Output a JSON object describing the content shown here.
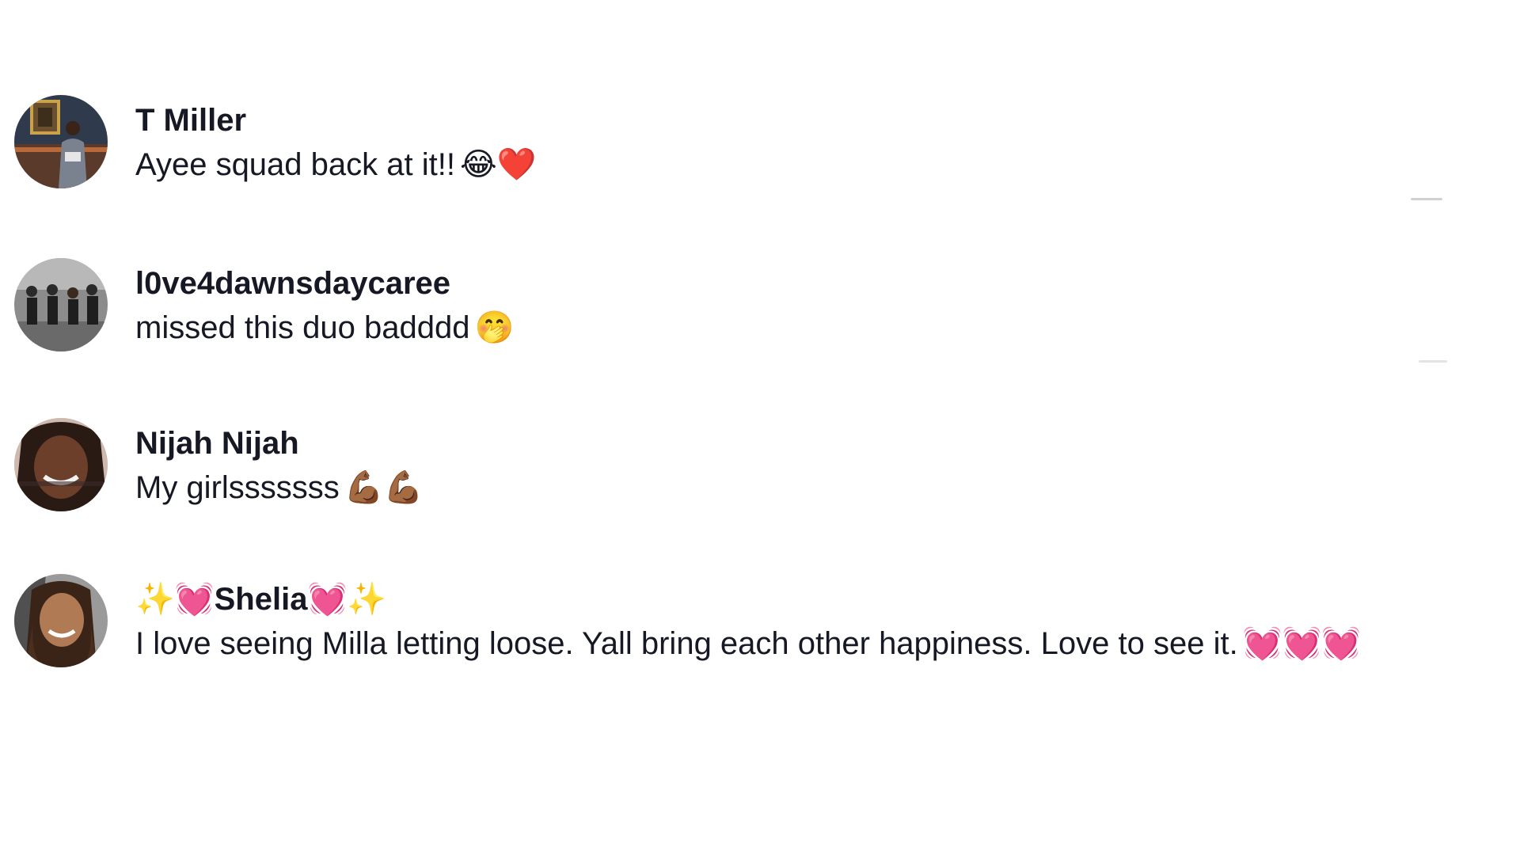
{
  "comments": [
    {
      "username": "T Miller",
      "text": "Ayee squad back at it!!",
      "emoji": "😂❤️"
    },
    {
      "username": "l0ve4dawnsdaycaree",
      "text": "missed this duo badddd",
      "emoji": "🤭"
    },
    {
      "username": "Nijah Nijah",
      "text": "My girlsssssss",
      "emoji": "💪🏾💪🏾"
    },
    {
      "username_prefix": "✨💓",
      "username": "Shelia",
      "username_suffix": "💓✨",
      "text": "I love seeing Milla letting loose. Yall bring each other happiness. Love to see it.",
      "emoji": "💓💓💓"
    }
  ],
  "colors": {
    "text": "#161823",
    "background": "#ffffff"
  }
}
